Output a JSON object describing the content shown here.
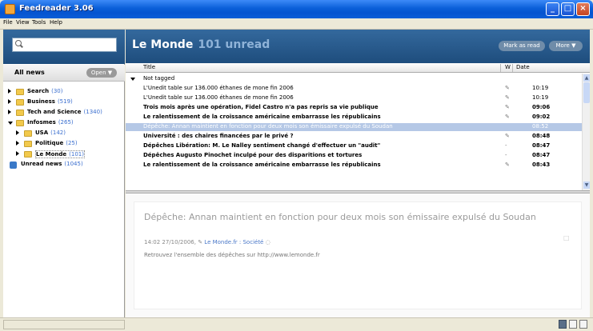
{
  "window": {
    "title": "Feedreader 3.06"
  },
  "menu": [
    "File",
    "View",
    "Tools",
    "Help"
  ],
  "sidebar": {
    "search": {
      "value": "",
      "placeholder": ""
    },
    "header_label": "All news",
    "open_button": "Open ▼",
    "items": [
      {
        "label": "Search",
        "count": "(30)",
        "expanded": false,
        "type": "folder"
      },
      {
        "label": "Business",
        "count": "(519)",
        "expanded": false,
        "type": "folder"
      },
      {
        "label": "Tech and Science",
        "count": "(1340)",
        "expanded": false,
        "type": "folder"
      },
      {
        "label": "Infosmes",
        "count": "(265)",
        "expanded": true,
        "type": "folder"
      },
      {
        "label": "USA",
        "count": "(142)",
        "expanded": false,
        "type": "folder"
      },
      {
        "label": "Politique",
        "count": "(25)",
        "expanded": false,
        "type": "folder"
      },
      {
        "label": "Le Monde",
        "count": "(101)",
        "expanded": false,
        "type": "folder"
      },
      {
        "label": "Unread news",
        "count": "(1045)",
        "type": "feed"
      }
    ]
  },
  "main": {
    "feed_title": "Le Monde",
    "unread_text": "101 unread",
    "mark_all_button": "Mark as read",
    "more_button": "More ▼",
    "columns": {
      "title": "Title",
      "flag": "W",
      "date": "Date"
    },
    "group_label": "Not tagged",
    "articles": [
      {
        "title": "L'Unedit table sur 136.000 éthanes de mone fin 2006",
        "flag": "✎",
        "date": "10:19",
        "bold": false,
        "selected": false
      },
      {
        "title": "L'Unedit table sur 136.000 éthanes de mone fin 2006",
        "flag": "✎",
        "date": "10:19",
        "bold": false,
        "selected": false
      },
      {
        "title": "Trois mois après une opération, Fidel Castro n'a pas repris sa vie publique",
        "flag": "✎",
        "date": "09:06",
        "bold": true,
        "selected": false
      },
      {
        "title": "Le ralentissement de la croissance américaine embarrasse les républicains",
        "flag": "✎",
        "date": "09:02",
        "bold": true,
        "selected": false
      },
      {
        "title": "Dépêche: Annan maintient en fonction pour deux mois son émissaire expulsé du Soudan",
        "flag": "",
        "date": "08:52",
        "bold": false,
        "selected": true
      },
      {
        "title": "Université : des chaires financées par le privé ?",
        "flag": "✎",
        "date": "08:48",
        "bold": true,
        "selected": false
      },
      {
        "title": "Dépêches Libération: M. Le Nalley sentiment changé d'effectuer un \"audit\"",
        "flag": "-",
        "date": "08:47",
        "bold": true,
        "selected": false
      },
      {
        "title": "Dépêches Augusto Pinochet inculpé pour des disparitions et tortures",
        "flag": "-",
        "date": "08:47",
        "bold": true,
        "selected": false
      },
      {
        "title": "Le ralentissement de la croissance américaine embarrasse les républicains",
        "flag": "✎",
        "date": "08:43",
        "bold": true,
        "selected": false
      }
    ]
  },
  "preview": {
    "heading": "Dépêche: Annan maintient en fonction pour deux mois son émissaire expulsé du Soudan",
    "meta_time": "14:02 27/10/2006,",
    "meta_link": "Le Monde.fr : Société",
    "body": "Retrouvez l'ensemble des dépêches sur http://www.lemonde.fr"
  }
}
